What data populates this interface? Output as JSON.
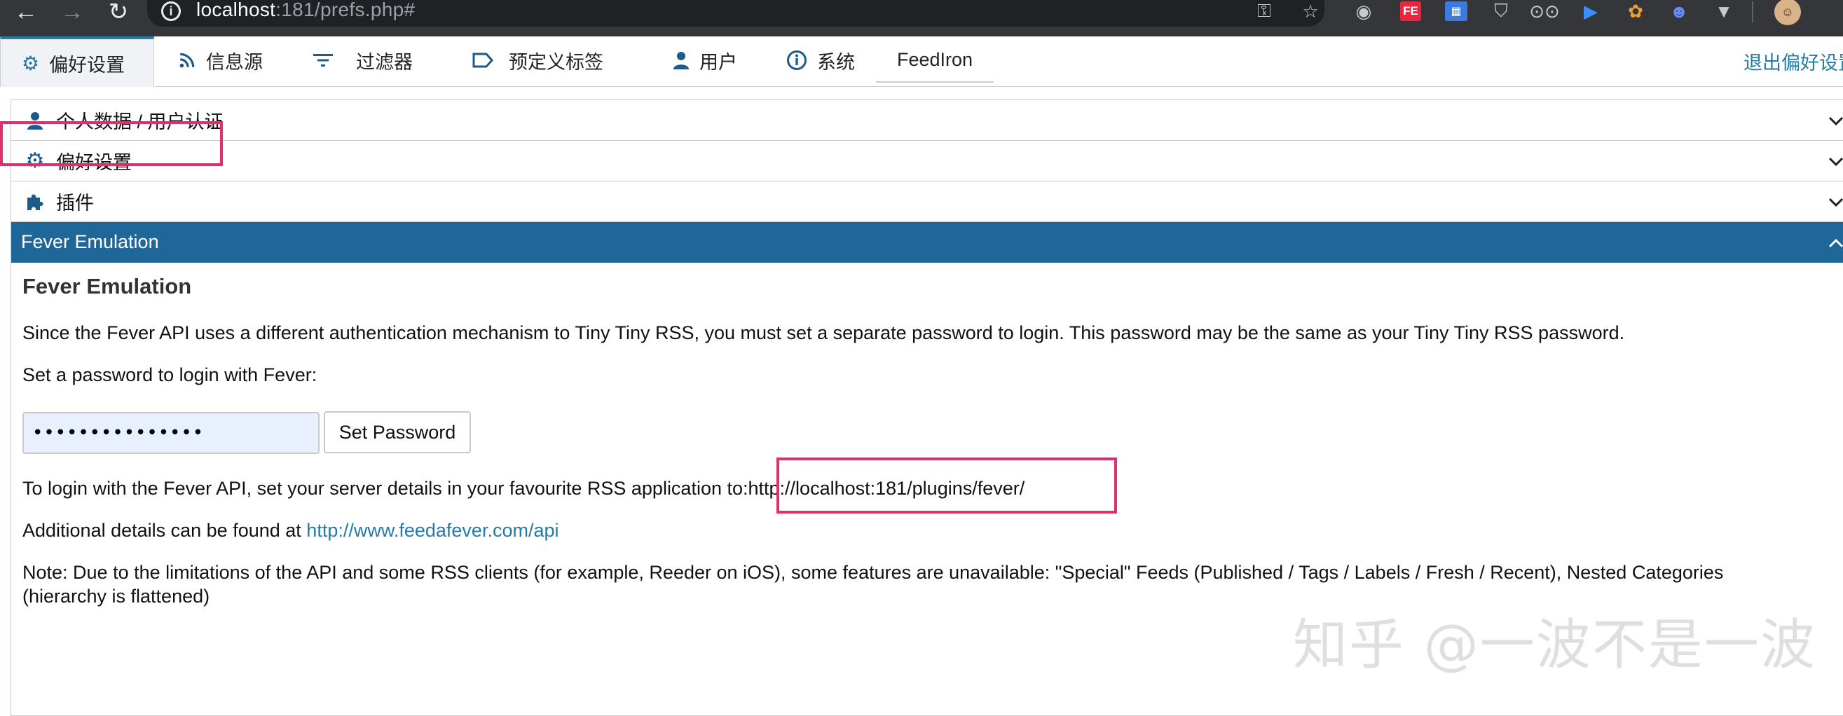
{
  "browser": {
    "url_host": "localhost",
    "url_rest": ":181/prefs.php#",
    "extensions": {
      "fe_label": "FE",
      "qr_label": "▦"
    }
  },
  "tabs": [
    {
      "label": "偏好设置",
      "icon": "gear-icon",
      "active": true
    },
    {
      "label": "信息源",
      "icon": "rss-icon"
    },
    {
      "label": "过滤器",
      "icon": "filter-icon"
    },
    {
      "label": "预定义标签",
      "icon": "label-icon"
    },
    {
      "label": "用户",
      "icon": "user-icon"
    },
    {
      "label": "系统",
      "icon": "info-icon"
    },
    {
      "label": "FeedIron"
    }
  ],
  "logout_label": "退出偏好设置",
  "accordion": [
    {
      "label": "个人数据 / 用户认证",
      "icon": "user-icon"
    },
    {
      "label": "偏好设置",
      "icon": "gear-icon"
    },
    {
      "label": "插件",
      "icon": "puzzle-icon"
    },
    {
      "label": "Fever Emulation",
      "open": true
    }
  ],
  "fever": {
    "heading": "Fever Emulation",
    "intro": "Since the Fever API uses a different authentication mechanism to Tiny Tiny RSS, you must set a separate password to login. This password may be the same as your Tiny Tiny RSS password.",
    "set_prompt": "Set a password to login with Fever:",
    "password_value": "•••••••••••••••",
    "set_button": "Set Password",
    "login_text": "To login with the Fever API, set your server details in your favourite RSS application to:",
    "login_url": "http://localhost:181/plugins/fever/",
    "details_prefix": "Additional details can be found at ",
    "details_link": "http://www.feedafever.com/api",
    "note_line1": "Note: Due to the limitations of the API and some RSS clients (for example, Reeder on iOS), some features are unavailable: \"Special\" Feeds (Published / Tags / Labels / Fresh / Recent), Nested Categories",
    "note_line2": "(hierarchy is flattened)"
  },
  "watermark": "知乎 @一波不是一波",
  "colors": {
    "accent": "#257aa6",
    "open_header": "#1f6699",
    "highlight_box": "#e0306a",
    "chrome_bg": "#35363a"
  }
}
